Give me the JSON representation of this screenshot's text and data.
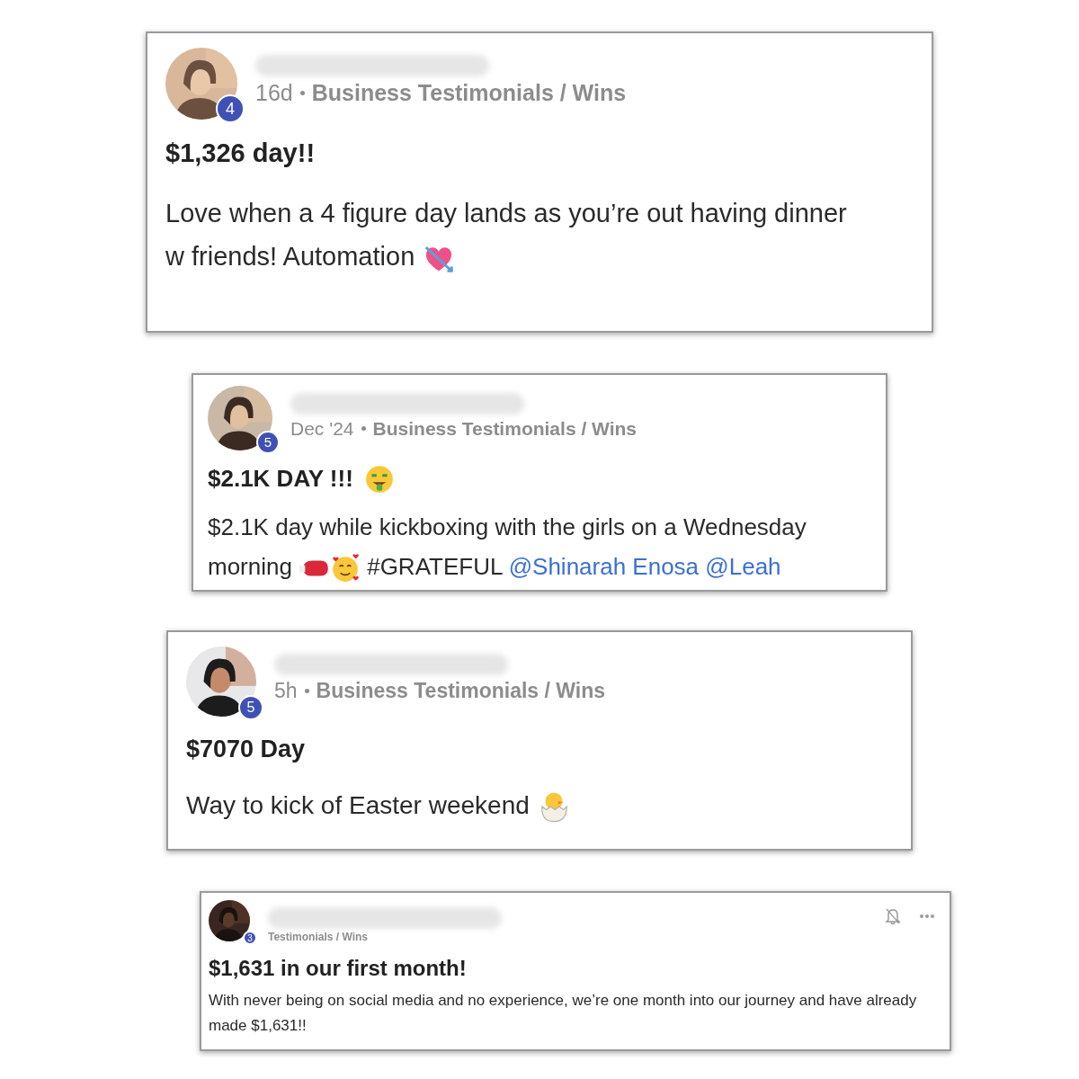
{
  "posts": [
    {
      "level": "4",
      "time": "16d",
      "category": "Business Testimonials / Wins",
      "title": "$1,326 day!!",
      "body": [
        {
          "kind": "text",
          "text": "Love when a 4 figure day lands as you’re out having dinner w friends! Automation"
        },
        {
          "kind": "emoji"
        }
      ]
    },
    {
      "level": "5",
      "time": "Dec '24",
      "category": "Business Testimonials / Wins",
      "title": "$2.1K DAY !!!",
      "title_emoji": true,
      "body": [
        {
          "kind": "text",
          "text": "$2.1K day while kickboxing with the girls on a Wednesday morning"
        },
        {
          "kind": "emoji"
        },
        {
          "kind": "emoji"
        },
        {
          "kind": "text",
          "text": "#GRATEFUL"
        },
        {
          "kind": "mention",
          "text": "@Shinarah Enosa"
        },
        {
          "kind": "mention",
          "text": "@Leah"
        }
      ]
    },
    {
      "level": "5",
      "time": "5h",
      "category": "Business Testimonials / Wins",
      "title": "$7070 Day",
      "body": [
        {
          "kind": "text",
          "text": "Way to kick of Easter weekend"
        },
        {
          "kind": "emoji"
        }
      ]
    },
    {
      "level": "3",
      "category": "Testimonials / Wins",
      "title": "$1,631 in our first month!",
      "actions": true,
      "body": [
        {
          "kind": "text",
          "text": "With never being on social media and no experience, we’re one month into our journey and have already made $1,631!!"
        }
      ]
    }
  ]
}
